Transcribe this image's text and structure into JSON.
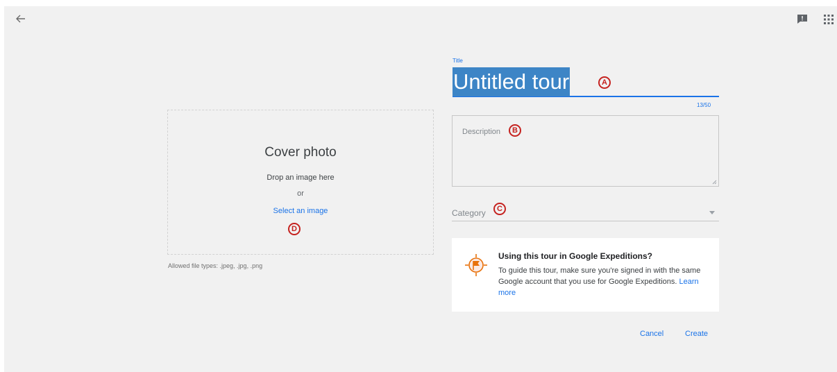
{
  "toolbar": {
    "back_icon": "arrow-left-icon",
    "feedback_icon": "feedback-icon",
    "apps_icon": "apps-grid-icon"
  },
  "cover_photo": {
    "title": "Cover photo",
    "drop_text": "Drop an image here",
    "or_text": "or",
    "select_link": "Select an image",
    "allowed_types": "Allowed file types: .jpeg, .jpg, .png"
  },
  "form": {
    "title_label": "Title",
    "title_value": "Untitled tour",
    "title_counter": "13/50",
    "description_placeholder": "Description",
    "category_label": "Category"
  },
  "expeditions_card": {
    "title": "Using this tour in Google Expeditions?",
    "body": "To guide this tour, make sure you're signed in with the same Google account that you use for Google Expeditions.",
    "link": "Learn more",
    "icon": "expeditions-flag-icon"
  },
  "actions": {
    "cancel": "Cancel",
    "create": "Create"
  },
  "annotations": {
    "a": "A",
    "b": "B",
    "c": "C",
    "d": "D"
  },
  "colors": {
    "accent": "#1a73e8",
    "annotation": "#c5221f",
    "highlight": "#3d85c6",
    "background": "#f1f1f1"
  }
}
